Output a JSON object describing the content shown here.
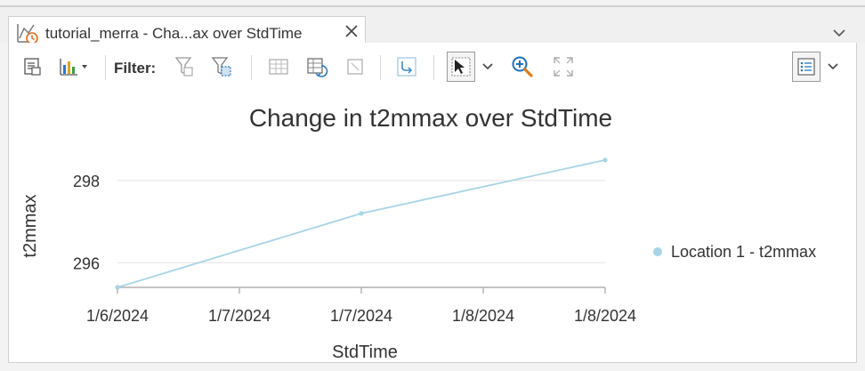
{
  "tab": {
    "title": "tutorial_merra - Cha...ax over StdTime",
    "icon": "chart-clock-icon"
  },
  "toolbar": {
    "filter_label": "Filter:"
  },
  "colors": {
    "series": "#a8d4e6",
    "grid": "#e6e6e6",
    "axis": "#b0b0b0",
    "text": "#333333"
  },
  "chart_data": {
    "type": "line",
    "title": "Change in t2mmax over StdTime",
    "xlabel": "StdTime",
    "ylabel": "t2mmax",
    "x_tick_labels": [
      "1/6/2024",
      "1/7/2024",
      "1/7/2024",
      "1/8/2024",
      "1/8/2024"
    ],
    "y_ticks": [
      296,
      298
    ],
    "ylim": [
      295.4,
      298.8
    ],
    "grid": "horizontal",
    "legend_position": "right",
    "series": [
      {
        "name": "Location 1 - t2mmax",
        "points": [
          {
            "x": "2024-01-06",
            "y": 295.4
          },
          {
            "x": "2024-01-07",
            "y": 297.2
          },
          {
            "x": "2024-01-08",
            "y": 298.5
          }
        ]
      }
    ]
  }
}
